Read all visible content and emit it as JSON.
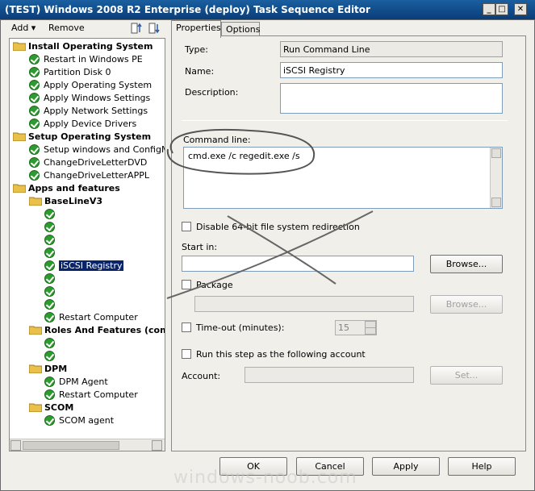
{
  "window": {
    "title": "(TEST) Windows 2008 R2 Enterprise (deploy) Task Sequence Editor",
    "minimize": "_",
    "maximize": "□",
    "close": "✕"
  },
  "toolbar": {
    "add": "Add ▾",
    "remove": "Remove"
  },
  "tree": {
    "groups": [
      {
        "label": "Install Operating System"
      },
      {
        "label": "Setup Operating System"
      },
      {
        "label": "Apps and features"
      },
      {
        "label": "BaseLineV3"
      },
      {
        "label": "Roles And Features (comm"
      },
      {
        "label": "DPM"
      },
      {
        "label": "SCOM"
      }
    ],
    "steps": [
      "Restart in Windows PE",
      "Partition Disk 0",
      "Apply Operating System",
      "Apply Windows Settings",
      "Apply Network Settings",
      "Apply Device Drivers",
      "Setup windows and ConfigMgr",
      "ChangeDriveLetterDVD",
      "ChangeDriveLetterAPPL",
      "iSCSI Registry",
      "Restart Computer",
      "DPM Agent",
      "Restart Computer",
      "SCOM agent"
    ]
  },
  "tabs": {
    "properties": "Properties",
    "options": "Options"
  },
  "props": {
    "type_label": "Type:",
    "type_value": "Run Command Line",
    "name_label": "Name:",
    "name_value": "iSCSI Registry",
    "description_label": "Description:",
    "description_value": "",
    "command_label": "Command line:",
    "command_value": "cmd.exe /c regedit.exe /s",
    "disable64_label": "Disable 64-bit file system redirection",
    "startin_label": "Start in:",
    "startin_value": "",
    "browse1": "Browse...",
    "package_label": "Package",
    "package_value": "",
    "browse2": "Browse...",
    "timeout_label": "Time-out (minutes):",
    "timeout_value": "15",
    "runas_label": "Run this step as the following account",
    "account_label": "Account:",
    "account_value": "",
    "set_label": "Set..."
  },
  "buttons": {
    "ok": "OK",
    "cancel": "Cancel",
    "apply": "Apply",
    "help": "Help"
  },
  "watermark": "windows-noob.com",
  "colors": {
    "title_bar": "#0a3d78",
    "selection": "#0a246a",
    "success": "#2f9a2f",
    "folder": "#e8c04a"
  }
}
